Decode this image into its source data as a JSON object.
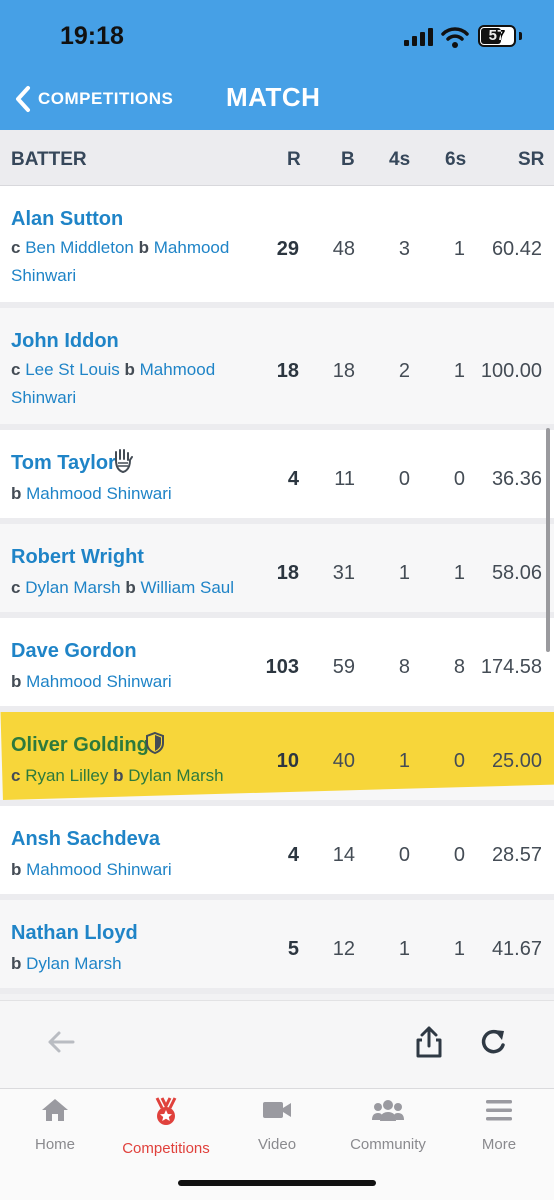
{
  "status": {
    "time": "19:18",
    "battery": "57"
  },
  "nav": {
    "back_label": "COMPETITIONS",
    "title": "MATCH"
  },
  "columns": {
    "batter": "BATTER",
    "r": "R",
    "b": "B",
    "fours": "4s",
    "sixes": "6s",
    "sr": "SR"
  },
  "batters": [
    {
      "name": "Alan Sutton",
      "d1": "c",
      "f1": "Ben Middleton",
      "d2": "b",
      "f2": "Mahmood",
      "cont": "Shinwari",
      "r": "29",
      "b": "48",
      "fours": "3",
      "sixes": "1",
      "sr": "60.42"
    },
    {
      "name": "John Iddon",
      "d1": "c",
      "f1": "Lee St Louis",
      "d2": "b",
      "f2": "Mahmood",
      "cont": "Shinwari",
      "r": "18",
      "b": "18",
      "fours": "2",
      "sixes": "1",
      "sr": "100.00"
    },
    {
      "name": "Tom Taylor",
      "d1": "b",
      "f1": "Mahmood Shinwari",
      "r": "4",
      "b": "11",
      "fours": "0",
      "sixes": "0",
      "sr": "36.36",
      "icon": "wicketkeeper-gloves-icon"
    },
    {
      "name": "Robert Wright",
      "d1": "c",
      "f1": "Dylan Marsh",
      "d2": "b",
      "f2": "William Saul",
      "r": "18",
      "b": "31",
      "fours": "1",
      "sixes": "1",
      "sr": "58.06"
    },
    {
      "name": "Dave Gordon",
      "d1": "b",
      "f1": "Mahmood Shinwari",
      "r": "103",
      "b": "59",
      "fours": "8",
      "sixes": "8",
      "sr": "174.58"
    },
    {
      "name": "Oliver Golding",
      "d1": "c",
      "f1": "Ryan Lilley",
      "d2": "b",
      "f2": "Dylan Marsh",
      "r": "10",
      "b": "40",
      "fours": "1",
      "sixes": "0",
      "sr": "25.00",
      "icon": "captain-shield-icon"
    },
    {
      "name": "Ansh Sachdeva",
      "d1": "b",
      "f1": "Mahmood Shinwari",
      "r": "4",
      "b": "14",
      "fours": "0",
      "sixes": "0",
      "sr": "28.57"
    },
    {
      "name": "Nathan Lloyd",
      "d1": "b",
      "f1": "Dylan Marsh",
      "r": "5",
      "b": "12",
      "fours": "1",
      "sixes": "1",
      "sr": "41.67"
    }
  ],
  "tabs": [
    {
      "label": "Home",
      "icon": "home-icon"
    },
    {
      "label": "Competitions",
      "icon": "medal-icon"
    },
    {
      "label": "Video",
      "icon": "video-camera-icon"
    },
    {
      "label": "Community",
      "icon": "community-icon"
    },
    {
      "label": "More",
      "icon": "menu-icon"
    }
  ],
  "colors": {
    "accent": "#46a0e6",
    "link": "#1f84c7",
    "active_tab": "#e0413c",
    "highlight": "#f7d63a"
  }
}
